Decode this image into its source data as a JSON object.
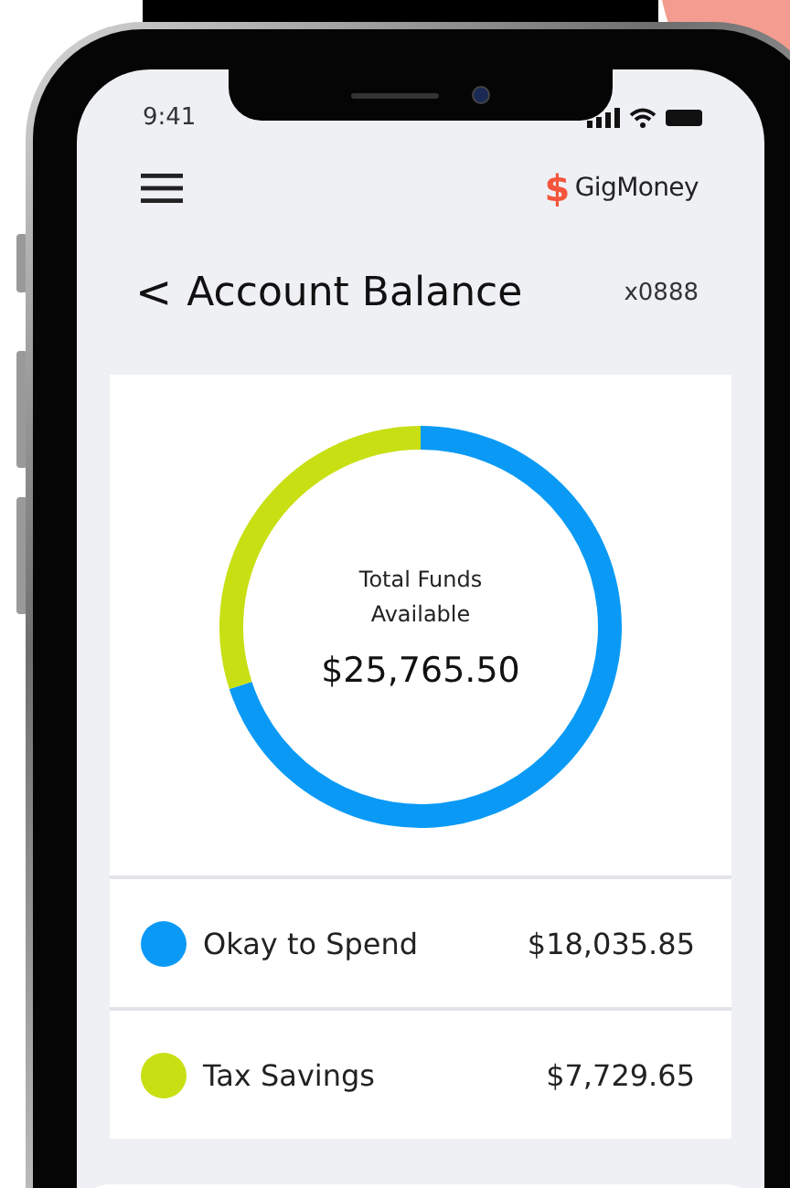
{
  "status_bar": {
    "time": "9:41"
  },
  "header": {
    "logo_mark": "$",
    "logo_text": "GigMoney"
  },
  "title_row": {
    "back": "<",
    "title": "Account Balance",
    "account": "x0888"
  },
  "balance_card": {
    "label": "Total Funds Available",
    "amount": "$25,765.50",
    "chart_data": {
      "type": "donut",
      "values": [
        70,
        30
      ]
    },
    "items": [
      {
        "name": "Okay to Spend",
        "amount": "$18,035.85",
        "color": "#0a9af5"
      },
      {
        "name": "Tax Savings",
        "amount": "$7,729.65",
        "color": "#c8df14"
      }
    ]
  }
}
